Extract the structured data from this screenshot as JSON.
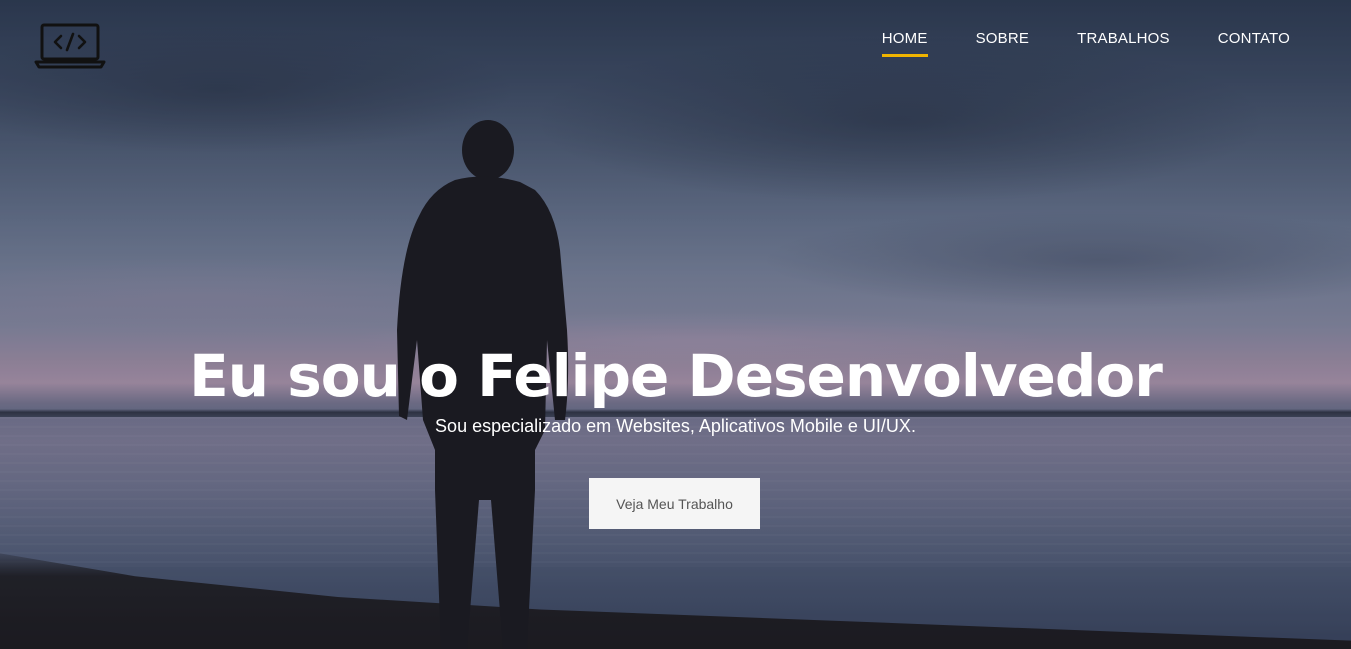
{
  "nav": {
    "logo_icon": "laptop-code-icon",
    "items": [
      {
        "label": "HOME",
        "active": true
      },
      {
        "label": "SOBRE",
        "active": false
      },
      {
        "label": "TRABALHOS",
        "active": false
      },
      {
        "label": "CONTATO",
        "active": false
      }
    ],
    "active_underline_color": "#f0b400"
  },
  "hero": {
    "title": "Eu sou o Felipe Desenvolvedor",
    "subtitle": "Sou especializado em Websites, Aplicativos Mobile e UI/UX.",
    "cta_label": "Veja Meu Trabalho"
  }
}
